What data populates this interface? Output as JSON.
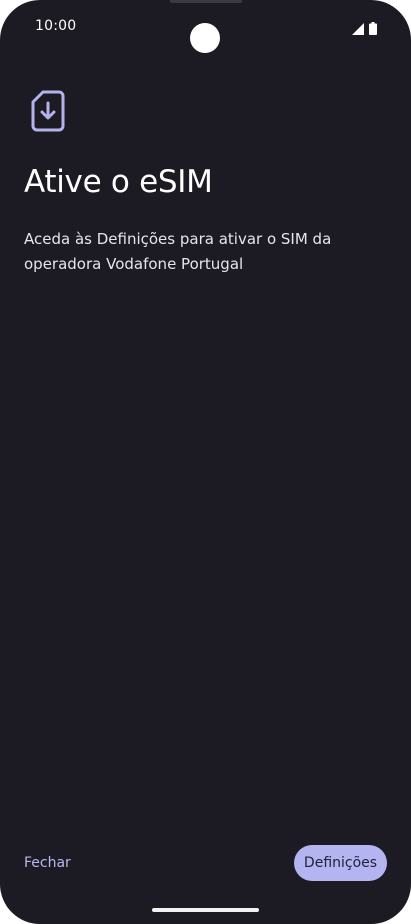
{
  "status_bar": {
    "time": "10:00",
    "icons": [
      "signal-icon",
      "battery-icon"
    ]
  },
  "page": {
    "icon": "sim-download-icon",
    "title": "Ative o eSIM",
    "description": "Aceda às Definições para ativar o SIM da operadora Vodafone Portugal"
  },
  "actions": {
    "close_label": "Fechar",
    "settings_label": "Definições"
  },
  "colors": {
    "background": "#1c1b23",
    "accent": "#b4b4f0",
    "accent_text": "#b7b7f2",
    "icon": "#b3b3ea"
  }
}
